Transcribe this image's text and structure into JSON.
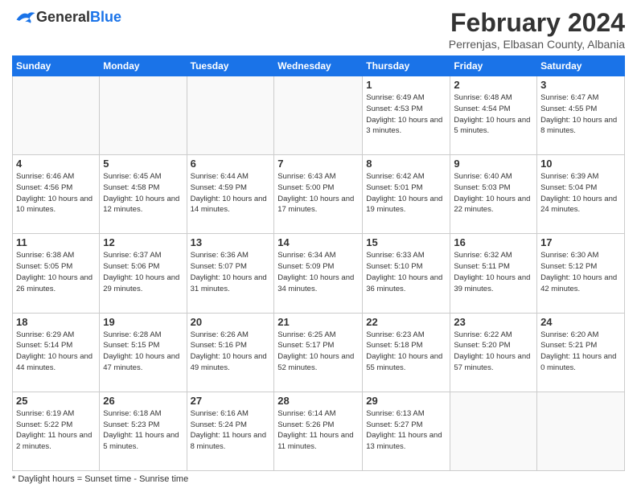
{
  "header": {
    "logo_general": "General",
    "logo_blue": "Blue",
    "title": "February 2024",
    "subtitle": "Perrenjas, Elbasan County, Albania"
  },
  "days_of_week": [
    "Sunday",
    "Monday",
    "Tuesday",
    "Wednesday",
    "Thursday",
    "Friday",
    "Saturday"
  ],
  "weeks": [
    [
      {
        "day": "",
        "info": ""
      },
      {
        "day": "",
        "info": ""
      },
      {
        "day": "",
        "info": ""
      },
      {
        "day": "",
        "info": ""
      },
      {
        "day": "1",
        "info": "Sunrise: 6:49 AM\nSunset: 4:53 PM\nDaylight: 10 hours\nand 3 minutes."
      },
      {
        "day": "2",
        "info": "Sunrise: 6:48 AM\nSunset: 4:54 PM\nDaylight: 10 hours\nand 5 minutes."
      },
      {
        "day": "3",
        "info": "Sunrise: 6:47 AM\nSunset: 4:55 PM\nDaylight: 10 hours\nand 8 minutes."
      }
    ],
    [
      {
        "day": "4",
        "info": "Sunrise: 6:46 AM\nSunset: 4:56 PM\nDaylight: 10 hours\nand 10 minutes."
      },
      {
        "day": "5",
        "info": "Sunrise: 6:45 AM\nSunset: 4:58 PM\nDaylight: 10 hours\nand 12 minutes."
      },
      {
        "day": "6",
        "info": "Sunrise: 6:44 AM\nSunset: 4:59 PM\nDaylight: 10 hours\nand 14 minutes."
      },
      {
        "day": "7",
        "info": "Sunrise: 6:43 AM\nSunset: 5:00 PM\nDaylight: 10 hours\nand 17 minutes."
      },
      {
        "day": "8",
        "info": "Sunrise: 6:42 AM\nSunset: 5:01 PM\nDaylight: 10 hours\nand 19 minutes."
      },
      {
        "day": "9",
        "info": "Sunrise: 6:40 AM\nSunset: 5:03 PM\nDaylight: 10 hours\nand 22 minutes."
      },
      {
        "day": "10",
        "info": "Sunrise: 6:39 AM\nSunset: 5:04 PM\nDaylight: 10 hours\nand 24 minutes."
      }
    ],
    [
      {
        "day": "11",
        "info": "Sunrise: 6:38 AM\nSunset: 5:05 PM\nDaylight: 10 hours\nand 26 minutes."
      },
      {
        "day": "12",
        "info": "Sunrise: 6:37 AM\nSunset: 5:06 PM\nDaylight: 10 hours\nand 29 minutes."
      },
      {
        "day": "13",
        "info": "Sunrise: 6:36 AM\nSunset: 5:07 PM\nDaylight: 10 hours\nand 31 minutes."
      },
      {
        "day": "14",
        "info": "Sunrise: 6:34 AM\nSunset: 5:09 PM\nDaylight: 10 hours\nand 34 minutes."
      },
      {
        "day": "15",
        "info": "Sunrise: 6:33 AM\nSunset: 5:10 PM\nDaylight: 10 hours\nand 36 minutes."
      },
      {
        "day": "16",
        "info": "Sunrise: 6:32 AM\nSunset: 5:11 PM\nDaylight: 10 hours\nand 39 minutes."
      },
      {
        "day": "17",
        "info": "Sunrise: 6:30 AM\nSunset: 5:12 PM\nDaylight: 10 hours\nand 42 minutes."
      }
    ],
    [
      {
        "day": "18",
        "info": "Sunrise: 6:29 AM\nSunset: 5:14 PM\nDaylight: 10 hours\nand 44 minutes."
      },
      {
        "day": "19",
        "info": "Sunrise: 6:28 AM\nSunset: 5:15 PM\nDaylight: 10 hours\nand 47 minutes."
      },
      {
        "day": "20",
        "info": "Sunrise: 6:26 AM\nSunset: 5:16 PM\nDaylight: 10 hours\nand 49 minutes."
      },
      {
        "day": "21",
        "info": "Sunrise: 6:25 AM\nSunset: 5:17 PM\nDaylight: 10 hours\nand 52 minutes."
      },
      {
        "day": "22",
        "info": "Sunrise: 6:23 AM\nSunset: 5:18 PM\nDaylight: 10 hours\nand 55 minutes."
      },
      {
        "day": "23",
        "info": "Sunrise: 6:22 AM\nSunset: 5:20 PM\nDaylight: 10 hours\nand 57 minutes."
      },
      {
        "day": "24",
        "info": "Sunrise: 6:20 AM\nSunset: 5:21 PM\nDaylight: 11 hours\nand 0 minutes."
      }
    ],
    [
      {
        "day": "25",
        "info": "Sunrise: 6:19 AM\nSunset: 5:22 PM\nDaylight: 11 hours\nand 2 minutes."
      },
      {
        "day": "26",
        "info": "Sunrise: 6:18 AM\nSunset: 5:23 PM\nDaylight: 11 hours\nand 5 minutes."
      },
      {
        "day": "27",
        "info": "Sunrise: 6:16 AM\nSunset: 5:24 PM\nDaylight: 11 hours\nand 8 minutes."
      },
      {
        "day": "28",
        "info": "Sunrise: 6:14 AM\nSunset: 5:26 PM\nDaylight: 11 hours\nand 11 minutes."
      },
      {
        "day": "29",
        "info": "Sunrise: 6:13 AM\nSunset: 5:27 PM\nDaylight: 11 hours\nand 13 minutes."
      },
      {
        "day": "",
        "info": ""
      },
      {
        "day": "",
        "info": ""
      }
    ]
  ],
  "footer": {
    "daylight_label": "Daylight hours"
  }
}
